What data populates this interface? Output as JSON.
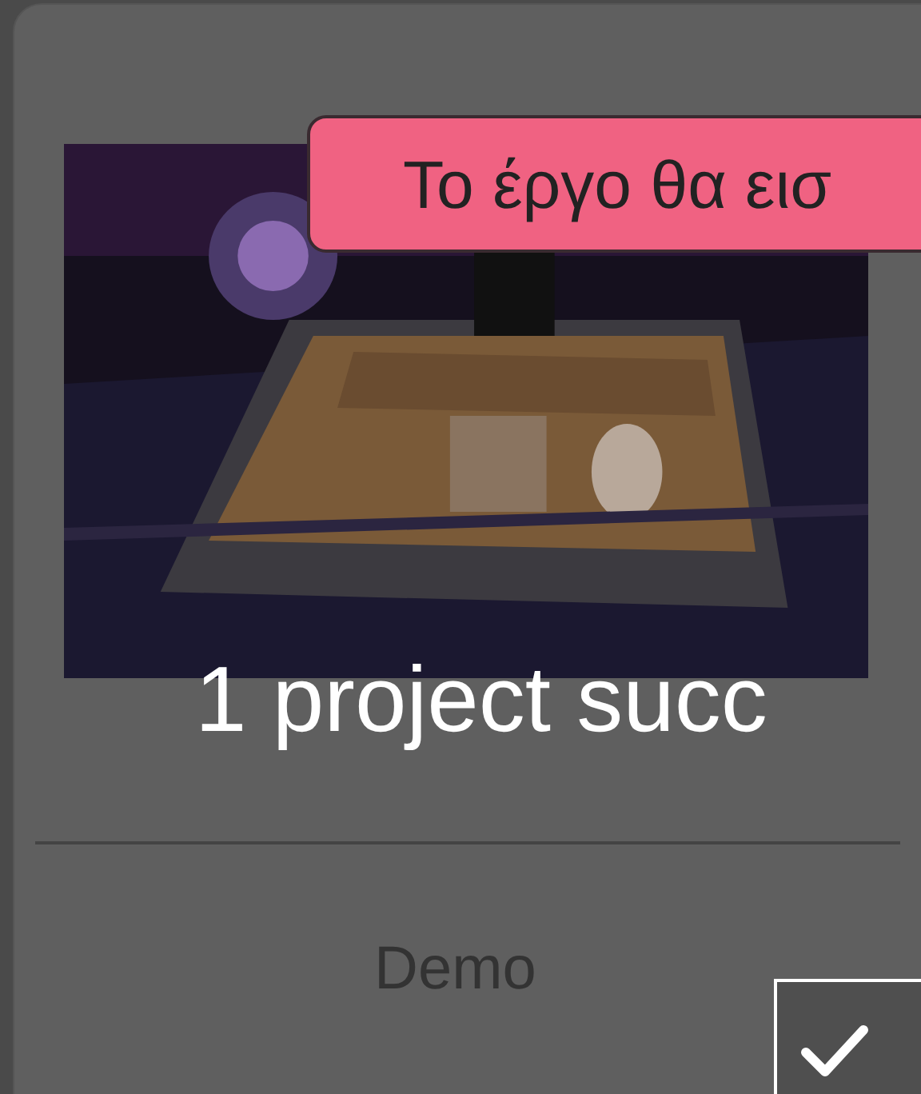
{
  "banner": {
    "text": "Το έργο θα εισ"
  },
  "card": {
    "overlay_text": "1 project succ",
    "label": "Demo",
    "checkbox": {
      "checked": true
    }
  }
}
